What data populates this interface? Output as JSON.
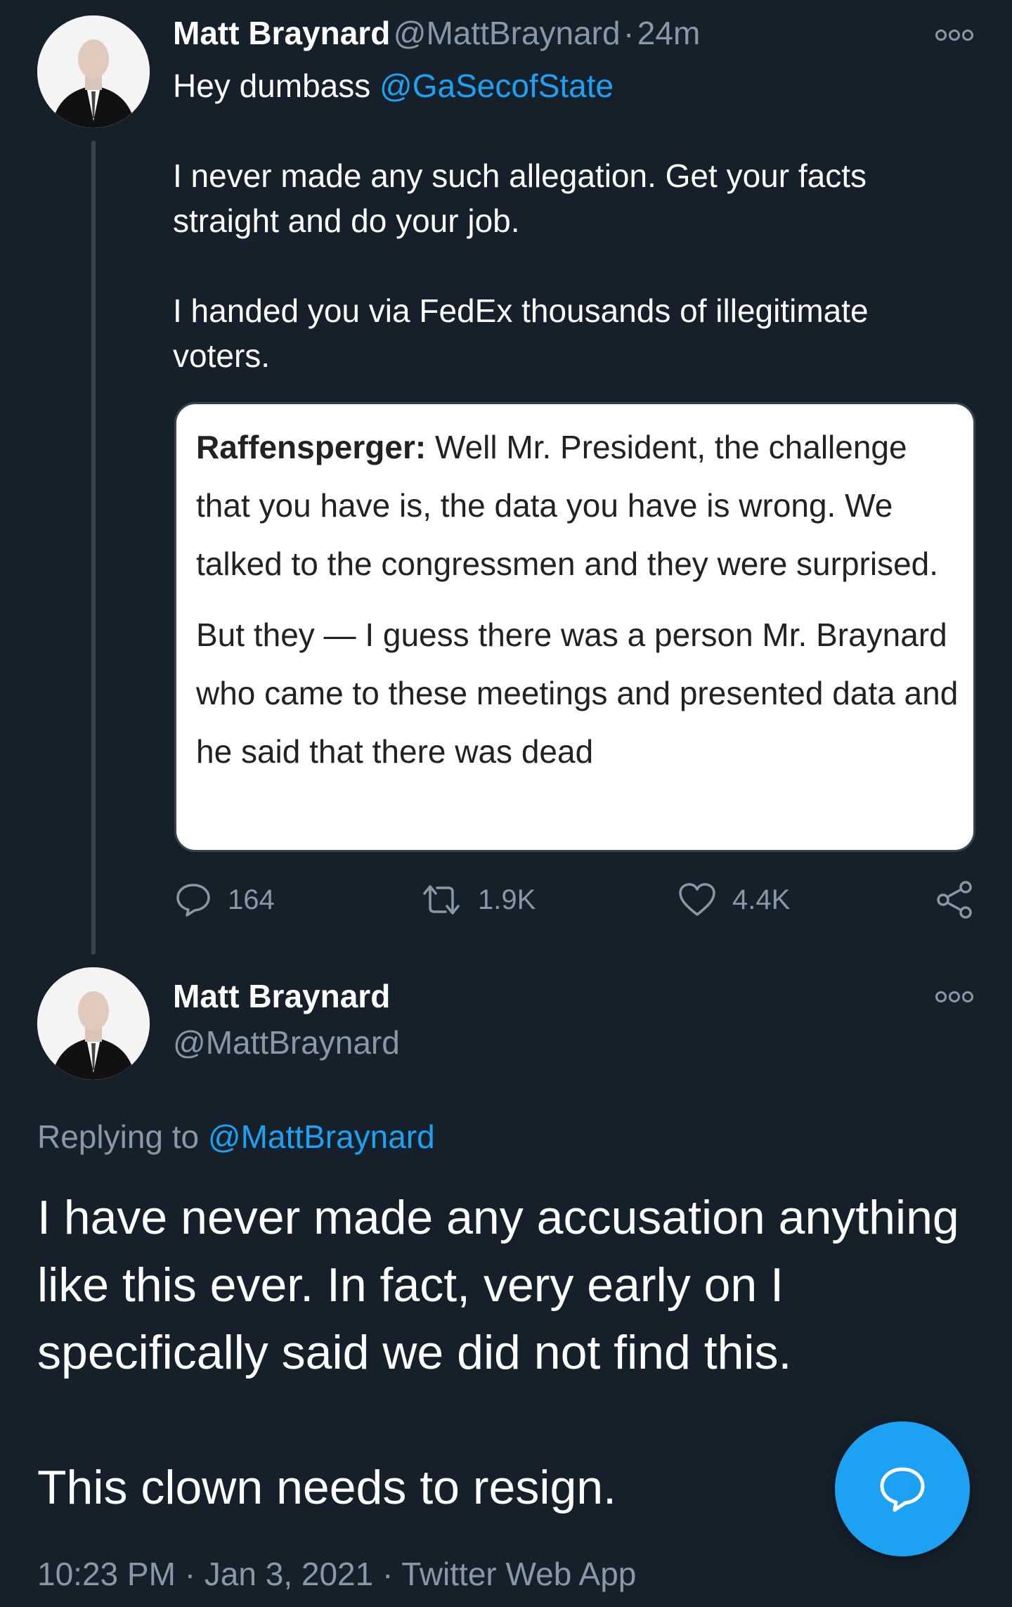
{
  "tweet1": {
    "name": "Matt Braynard",
    "handle": "@MattBraynard",
    "separator": "·",
    "time": "24m",
    "text_prefix": "Hey dumbass ",
    "mention": "@GaSecofState",
    "paragraph1": "I never made any such allegation. Get your facts straight and do your job.",
    "paragraph2": "I handed you via FedEx thousands of illegitimate voters.",
    "embed": {
      "speaker": "Raffensperger:",
      "para1_rest": " Well Mr. President, the challenge that you have is, the data you have is wrong. We talked to the congressmen and they were surprised.",
      "para2": "But they — I guess there was a person Mr. Braynard who came to these meetings and presented data and he said that there was dead"
    },
    "replies": "164",
    "retweets": "1.9K",
    "likes": "4.4K"
  },
  "tweet2": {
    "name": "Matt Braynard",
    "handle": "@MattBraynard",
    "replying_label": "Replying to ",
    "replying_handle": "@MattBraynard",
    "paragraph1": "I have never made any accusation anything like this ever. In fact, very early on I specifically said we did not find this.",
    "paragraph2": "This clown needs to resign.",
    "time": "10:23 PM",
    "sep": "·",
    "date": "Jan 3, 2021",
    "source": "Twitter Web App"
  },
  "colors": {
    "background": "#15202b",
    "accent": "#1da1f2",
    "muted": "#8899a6"
  },
  "icons": [
    "avatar",
    "more-icon",
    "reply-icon",
    "retweet-icon",
    "like-icon",
    "share-icon",
    "compose-reply-icon"
  ]
}
